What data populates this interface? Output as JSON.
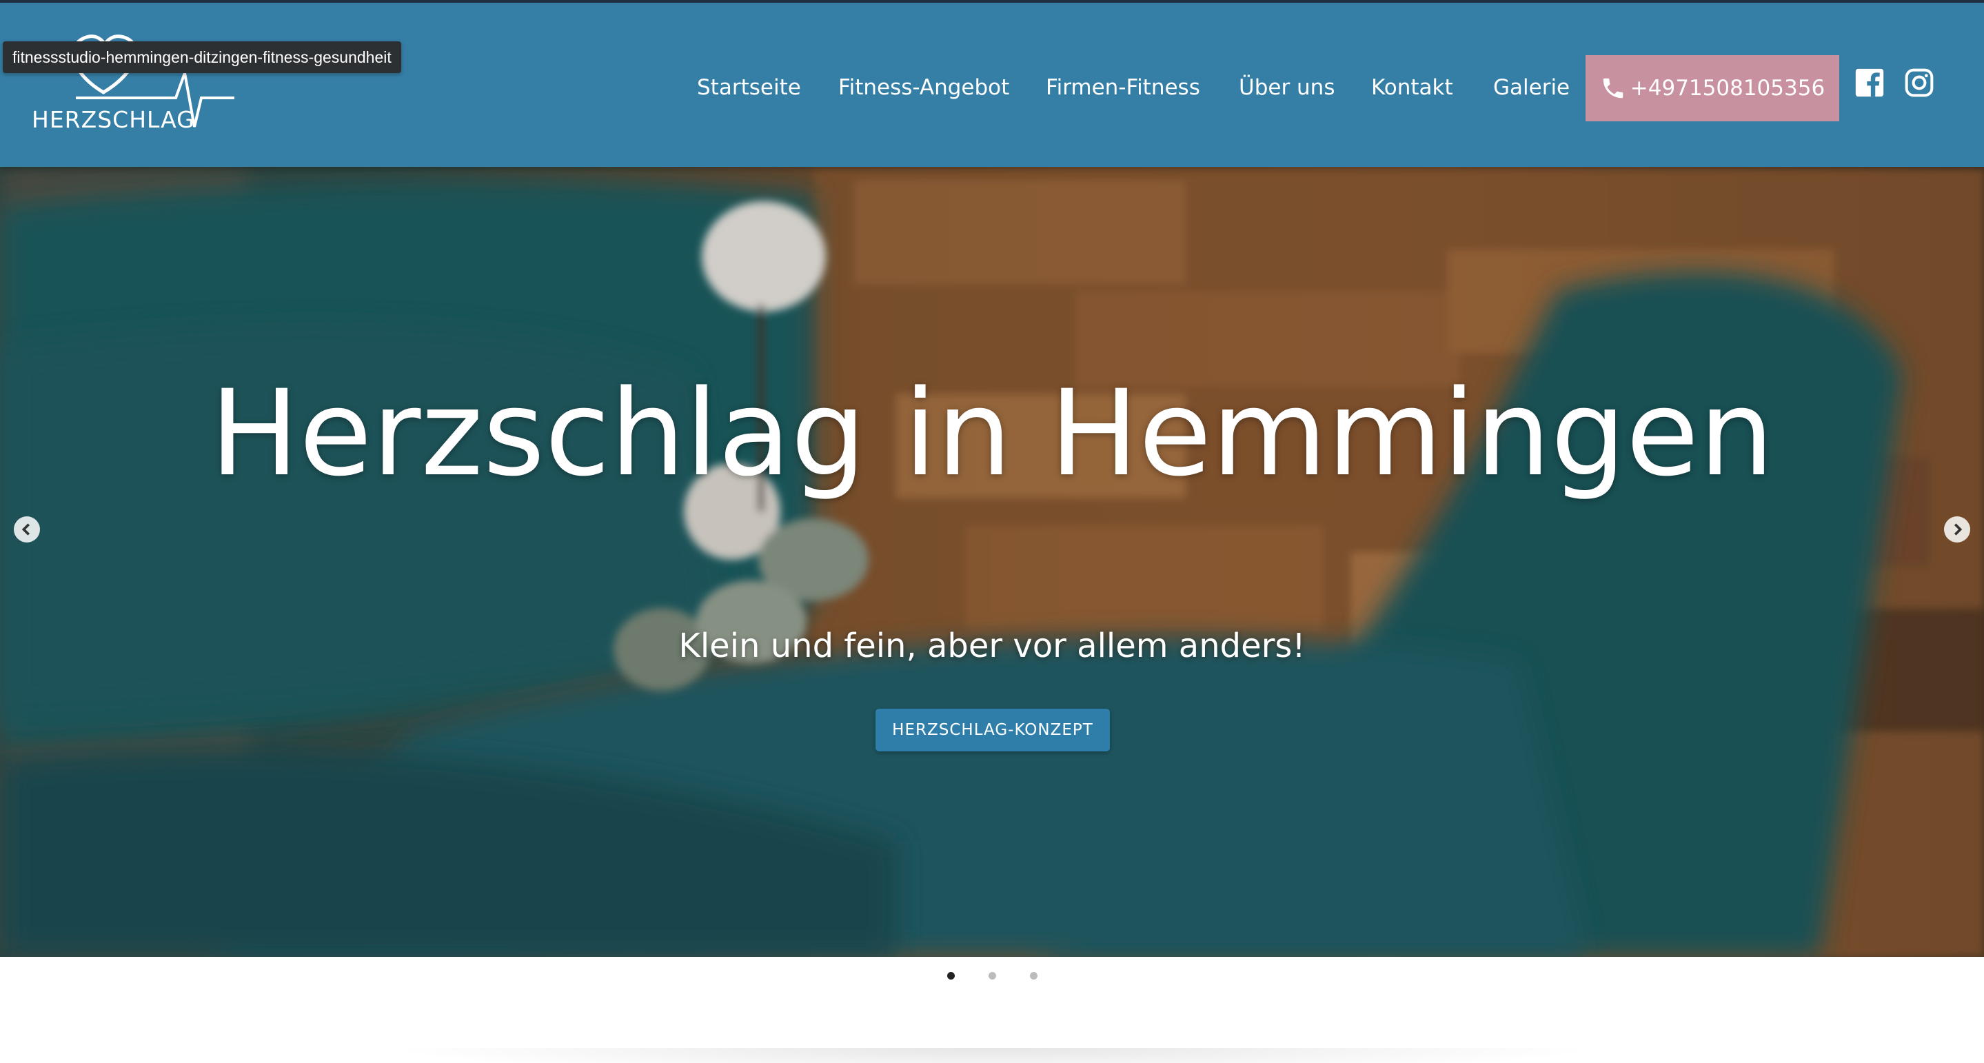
{
  "tooltip": "fitnessstudio-hemmingen-ditzingen-fitness-gesundheit",
  "logo": {
    "text": "HERZSCHLAG"
  },
  "nav": {
    "items": [
      {
        "label": "Startseite"
      },
      {
        "label": "Fitness-Angebot"
      },
      {
        "label": "Firmen-Fitness"
      },
      {
        "label": "Über uns"
      },
      {
        "label": "Kontakt"
      },
      {
        "label": "Galerie"
      }
    ],
    "phone": "+4971508105356"
  },
  "hero": {
    "title": "Herzschlag in Hemmingen",
    "subtitle": "Klein und fein, aber vor allem anders!",
    "cta_label": "HERZSCHLAG-KONZEPT"
  },
  "slider": {
    "slide_count": 3,
    "active_index": 0
  },
  "colors": {
    "header_bg": "#357ea5",
    "phone_button_bg": "#c8919f",
    "cta_bg": "#2f7ea9"
  },
  "icons": {
    "phone": "phone-icon",
    "facebook": "facebook-icon",
    "instagram": "instagram-icon",
    "prev": "chevron-left-icon",
    "next": "chevron-right-icon"
  }
}
